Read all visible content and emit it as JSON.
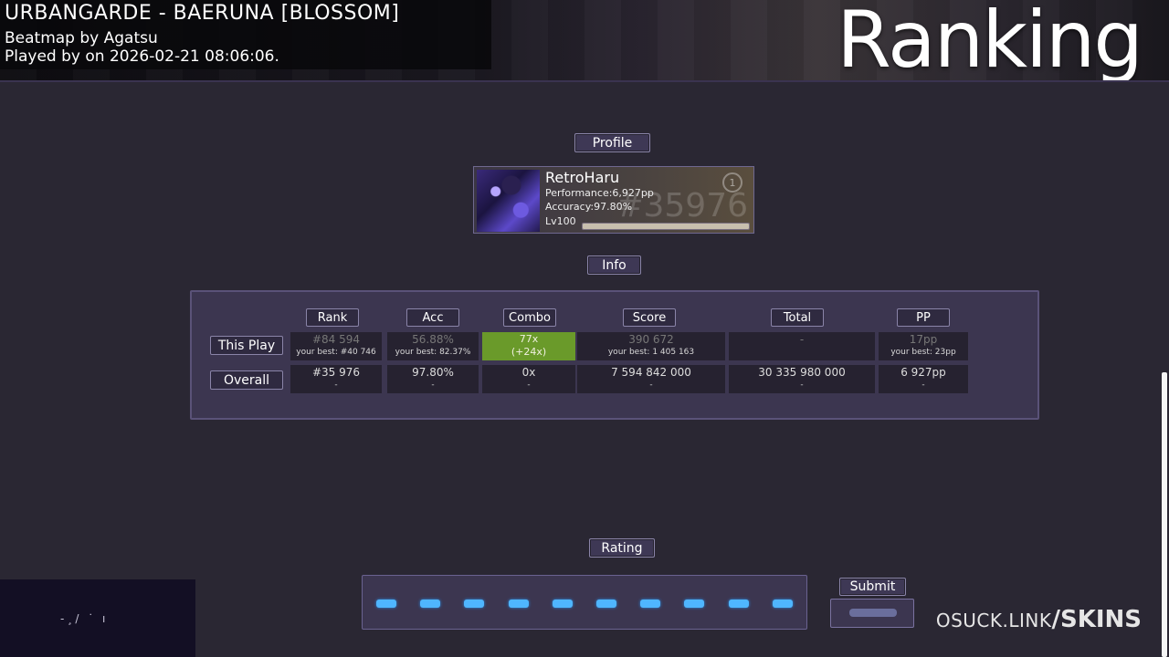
{
  "header": {
    "song_title": "URBANGARDE - BAERUNA [BLOSSOM]",
    "mapper": "Beatmap by Agatsu",
    "played": "Played by  on 2026-02-21 08:06:06.",
    "screen_title": "Ranking"
  },
  "profile": {
    "section_label": "Profile",
    "name": "RetroHaru",
    "performance": "Performance:6,927pp",
    "accuracy": "Accuracy:97.80%",
    "level": "Lv100",
    "rank_bg": "#35976",
    "badge": "1",
    "level_progress": 1.0
  },
  "info": {
    "section_label": "Info",
    "columns": [
      "Rank",
      "Acc",
      "Combo",
      "Score",
      "Total",
      "PP"
    ],
    "rows": {
      "this_play": {
        "label": "This Play",
        "cells": [
          {
            "value": "#84 594",
            "sub": "your best: #40 746"
          },
          {
            "value": "56.88%",
            "sub": "your best: 82.37%"
          },
          {
            "value": "77x",
            "sub": "(+24x)"
          },
          {
            "value": "390 672",
            "sub": "your best: 1 405 163"
          },
          {
            "value": "-",
            "sub": ""
          },
          {
            "value": "17pp",
            "sub": "your best: 23pp"
          }
        ]
      },
      "overall": {
        "label": "Overall",
        "cells": [
          {
            "value": "#35 976",
            "sub": "-"
          },
          {
            "value": "97.80%",
            "sub": "-"
          },
          {
            "value": "0x",
            "sub": "-"
          },
          {
            "value": "7 594 842 000",
            "sub": "-"
          },
          {
            "value": "30 335 980 000",
            "sub": "-"
          },
          {
            "value": "6 927pp",
            "sub": "-"
          }
        ]
      }
    },
    "highlight_color": "#6a9a2a"
  },
  "rating": {
    "section_label": "Rating",
    "dot_count": 10,
    "dot_color": "#4fb6ff"
  },
  "submit": {
    "label": "Submit"
  },
  "preview": {
    "glyphs": "-¸/ ˙ ı"
  },
  "watermark": {
    "part_a": "OSUCK.LINK",
    "part_b": "/SKINS"
  }
}
